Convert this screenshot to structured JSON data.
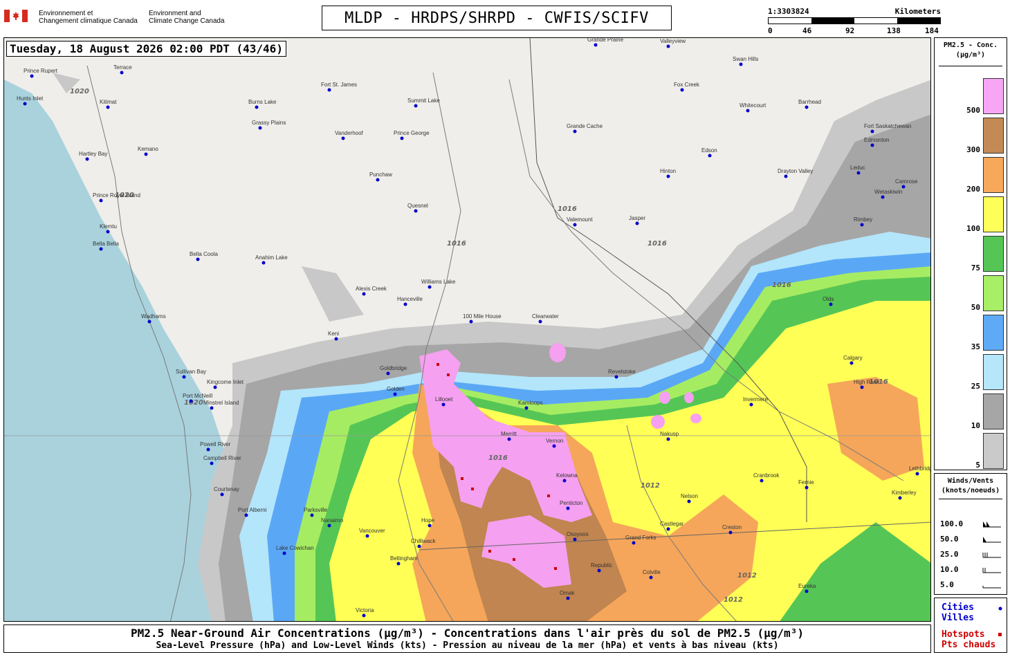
{
  "header": {
    "gov_fr_1": "Environnement et",
    "gov_fr_2": "Changement climatique Canada",
    "gov_en_1": "Environment and",
    "gov_en_2": "Climate Change Canada",
    "title": "MLDP - HRDPS/SHRPD - CWFIS/SCIFV"
  },
  "scale_bar": {
    "ratio": "1:3303824",
    "unit": "Kilometers",
    "ticks": [
      "0",
      "46",
      "92",
      "138",
      "184"
    ]
  },
  "map": {
    "timestamp": "Tuesday, 18 August 2026 02:00 PDT (43/46)",
    "colors": {
      "ocean": "#a9d2dd",
      "land": "#f0eeea",
      "conc_5": "#c8c8c8",
      "conc_10": "#a6a6a6",
      "conc_25": "#b3e5fb",
      "conc_35": "#5aa8f5",
      "conc_50": "#a6ec62",
      "conc_75": "#55c655",
      "conc_100": "#ffff55",
      "conc_200": "#f5a65a",
      "conc_300": "#c08550",
      "conc_500": "#f5a0f0",
      "city": "#0000cc",
      "hotspot": "#cc0000"
    },
    "cities": [
      {
        "name": "Terrace"
      },
      {
        "name": "Prince Rupert"
      },
      {
        "name": "Hunts Inlet"
      },
      {
        "name": "Kitimat"
      },
      {
        "name": "Burns Lake"
      },
      {
        "name": "Fort St. James"
      },
      {
        "name": "Vanderhoof"
      },
      {
        "name": "Prince George"
      },
      {
        "name": "Summit Lake"
      },
      {
        "name": "Grassy Plains"
      },
      {
        "name": "Kemano"
      },
      {
        "name": "Hartley Bay"
      },
      {
        "name": "Prince Royal Island"
      },
      {
        "name": "Klemtu"
      },
      {
        "name": "Bella Bella"
      },
      {
        "name": "Bella Coola"
      },
      {
        "name": "Anahim Lake"
      },
      {
        "name": "Punchaw"
      },
      {
        "name": "Quesnel"
      },
      {
        "name": "Williams Lake"
      },
      {
        "name": "Alexis Creek"
      },
      {
        "name": "Hanceville"
      },
      {
        "name": "100 Mile House"
      },
      {
        "name": "Clearwater"
      },
      {
        "name": "Kamloops"
      },
      {
        "name": "Valemount"
      },
      {
        "name": "Jasper"
      },
      {
        "name": "Hinton"
      },
      {
        "name": "Edson"
      },
      {
        "name": "Grande Cache"
      },
      {
        "name": "Grande Prairie"
      },
      {
        "name": "Valleyview"
      },
      {
        "name": "Fox Creek"
      },
      {
        "name": "Swan Hills"
      },
      {
        "name": "Whitecourt"
      },
      {
        "name": "Barrhead"
      },
      {
        "name": "Edmonton"
      },
      {
        "name": "Fort Saskatchewan"
      },
      {
        "name": "Leduc"
      },
      {
        "name": "Drayton Valley"
      },
      {
        "name": "Camrose"
      },
      {
        "name": "Wetaskiwin"
      },
      {
        "name": "Rimbey"
      },
      {
        "name": "Olds"
      },
      {
        "name": "Calgary"
      },
      {
        "name": "High River"
      },
      {
        "name": "Revelstoke"
      },
      {
        "name": "Golden"
      },
      {
        "name": "Invermere"
      },
      {
        "name": "Vernon"
      },
      {
        "name": "Kelowna"
      },
      {
        "name": "Penticton"
      },
      {
        "name": "Osoyoos"
      },
      {
        "name": "Grand Forks"
      },
      {
        "name": "Merritt"
      },
      {
        "name": "Hope"
      },
      {
        "name": "Chilliwack"
      },
      {
        "name": "Vancouver"
      },
      {
        "name": "Bellingham"
      },
      {
        "name": "Victoria"
      },
      {
        "name": "Nanaimo"
      },
      {
        "name": "Port Alberni"
      },
      {
        "name": "Courtenay"
      },
      {
        "name": "Campbell River"
      },
      {
        "name": "Port McNeill"
      },
      {
        "name": "Sullivan Bay"
      },
      {
        "name": "Kingcome Inlet"
      },
      {
        "name": "Minstrel Island"
      },
      {
        "name": "Powell River"
      },
      {
        "name": "Nelson"
      },
      {
        "name": "Castlegar"
      },
      {
        "name": "Cranbrook"
      },
      {
        "name": "Fernie"
      },
      {
        "name": "Creston"
      },
      {
        "name": "Kimberley"
      },
      {
        "name": "Colville"
      },
      {
        "name": "Republic"
      },
      {
        "name": "Omak"
      },
      {
        "name": "Lethbridge"
      },
      {
        "name": "Eureka"
      },
      {
        "name": "Nakusp"
      },
      {
        "name": "Wadhams"
      },
      {
        "name": "Lake Cowichan"
      },
      {
        "name": "Parksville"
      },
      {
        "name": "Lillooet"
      },
      {
        "name": "Goldbridge"
      },
      {
        "name": "Keni"
      }
    ],
    "isobar_labels": [
      "1016",
      "1020",
      "1012"
    ]
  },
  "legend": {
    "title_1": "PM2.5 - Conc.",
    "title_2": "(µg/m³)",
    "levels": [
      {
        "label": "500",
        "color": "#f7a6f5"
      },
      {
        "label": "300",
        "color": "#c48a55"
      },
      {
        "label": "200",
        "color": "#f7a85a"
      },
      {
        "label": "100",
        "color": "#ffff5a"
      },
      {
        "label": "75",
        "color": "#55c655"
      },
      {
        "label": "50",
        "color": "#a8ee66"
      },
      {
        "label": "35",
        "color": "#5eaaf7"
      },
      {
        "label": "25",
        "color": "#b5e6fa"
      },
      {
        "label": "10",
        "color": "#a6a6a6"
      },
      {
        "label": "5",
        "color": "#cacaca"
      }
    ]
  },
  "winds_legend": {
    "title_1": "Winds/Vents",
    "title_2": "(knots/noeuds)",
    "rows": [
      {
        "label": "100.0"
      },
      {
        "label": "50.0"
      },
      {
        "label": "25.0"
      },
      {
        "label": "10.0"
      },
      {
        "label": "5.0"
      }
    ]
  },
  "key": {
    "cities_en": "Cities",
    "cities_fr": "Villes",
    "hotspots_en": "Hotspots",
    "hotspots_fr": "Pts chauds"
  },
  "footer": {
    "line1": "PM2.5 Near-Ground Air Concentrations (µg/m³) - Concentrations dans l'air près du sol de PM2.5 (µg/m³)",
    "line2": "Sea-Level Pressure (hPa) and Low-Level Winds (kts) - Pression au niveau de la mer (hPa) et vents à bas niveau (kts)"
  }
}
